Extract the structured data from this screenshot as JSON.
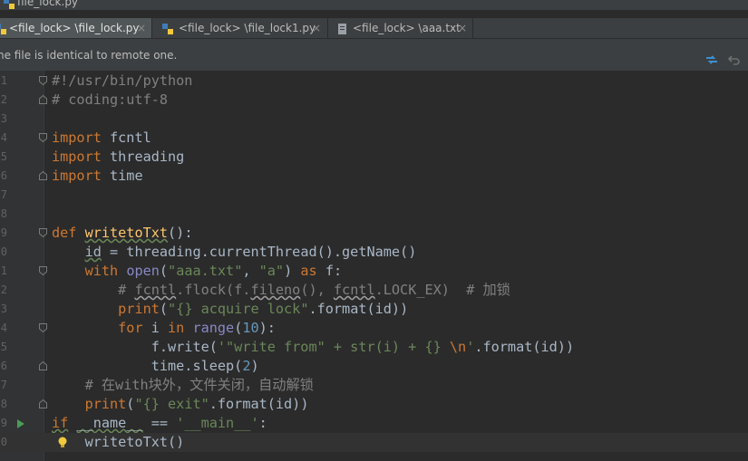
{
  "window": {
    "file_crumb": "file_lock.py"
  },
  "tabs": [
    {
      "label": "<file_lock> \\file_lock.py",
      "active": true,
      "icon": "python-file-icon"
    },
    {
      "label": "<file_lock> \\file_lock1.py",
      "active": false,
      "icon": "python-file-icon"
    },
    {
      "label": "<file_lock> \\aaa.txt",
      "active": false,
      "icon": "text-file-icon"
    }
  ],
  "tab_close_glyph": "×",
  "notice": {
    "message": "he file is identical to remote one.",
    "actions": [
      "sync-arrows-icon",
      "revert-icon"
    ]
  },
  "editor": {
    "line_numbers": [
      "1",
      "2",
      "3",
      "4",
      "5",
      "6",
      "7",
      "8",
      "9",
      "0",
      "1",
      "2",
      "3",
      "4",
      "5",
      "6",
      "7",
      "8",
      "9",
      "0"
    ],
    "code_lines": [
      "#!/usr/bin/python",
      "# coding:utf-8",
      "",
      "import fcntl",
      "import threading",
      "import time",
      "",
      "",
      "def writetoTxt():",
      "    id = threading.currentThread().getName()",
      "    with open(\"aaa.txt\", \"a\") as f:",
      "        # fcntl.flock(f.fileno(), fcntl.LOCK_EX)  # 加锁",
      "        print(\"{} acquire lock\".format(id))",
      "        for i in range(10):",
      "            f.write('\"write from\" + str(i) + {} \\n'.format(id))",
      "            time.sleep(2)",
      "    # 在with块外，文件关闭，自动解锁",
      "    print(\"{} exit\".format(id))",
      "if __name__ == '__main__':",
      "    writetoTxt()"
    ]
  },
  "colors": {
    "background": "#2b2b2b",
    "keyword": "#cc7832",
    "string": "#6a8759",
    "number": "#6897bb",
    "comment": "#808080",
    "builtin": "#8888c6",
    "function": "#ffc66d",
    "default": "#a9b7c6"
  }
}
